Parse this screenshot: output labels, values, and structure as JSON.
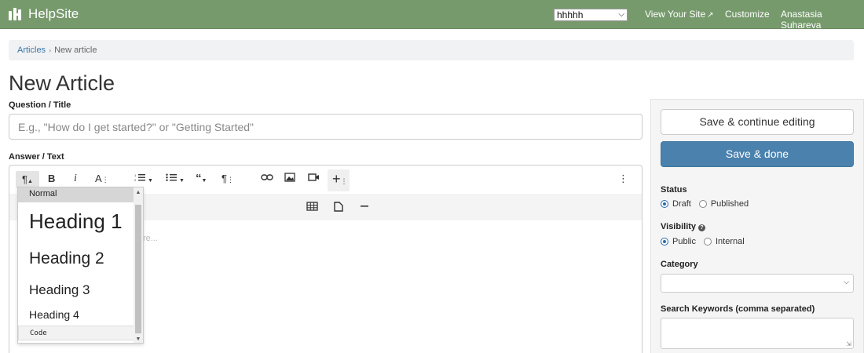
{
  "app": {
    "name": "HelpSite"
  },
  "topnav": {
    "site_select_value": "hhhhh",
    "view_site": "View Your Site",
    "customize": "Customize",
    "user": "Anastasia Suhareva"
  },
  "breadcrumb": {
    "articles": "Articles",
    "separator": "›",
    "current": "New article"
  },
  "page": {
    "title": "New Article"
  },
  "form": {
    "title_label": "Question / Title",
    "title_placeholder": "E.g., \"How do I get started?\" or \"Getting Started\"",
    "answer_label": "Answer / Text",
    "editor_placeholder": "re..."
  },
  "toolbar": {
    "paragraph": "¶",
    "bold": "B",
    "italic": "i",
    "font_size": "A",
    "more": "⋮"
  },
  "format_dropdown": {
    "items": [
      "Normal",
      "Heading 1",
      "Heading 2",
      "Heading 3",
      "Heading 4",
      "Code"
    ]
  },
  "sidebar": {
    "save_continue": "Save & continue editing",
    "save_done": "Save & done",
    "status_label": "Status",
    "status_options": [
      "Draft",
      "Published"
    ],
    "status_selected": "Draft",
    "visibility_label": "Visibility",
    "visibility_options": [
      "Public",
      "Internal"
    ],
    "visibility_selected": "Public",
    "category_label": "Category",
    "keywords_label": "Search Keywords (comma separated)"
  },
  "colors": {
    "nav_bg": "#779a6d",
    "primary": "#4a81ad",
    "link": "#3a77a8"
  }
}
